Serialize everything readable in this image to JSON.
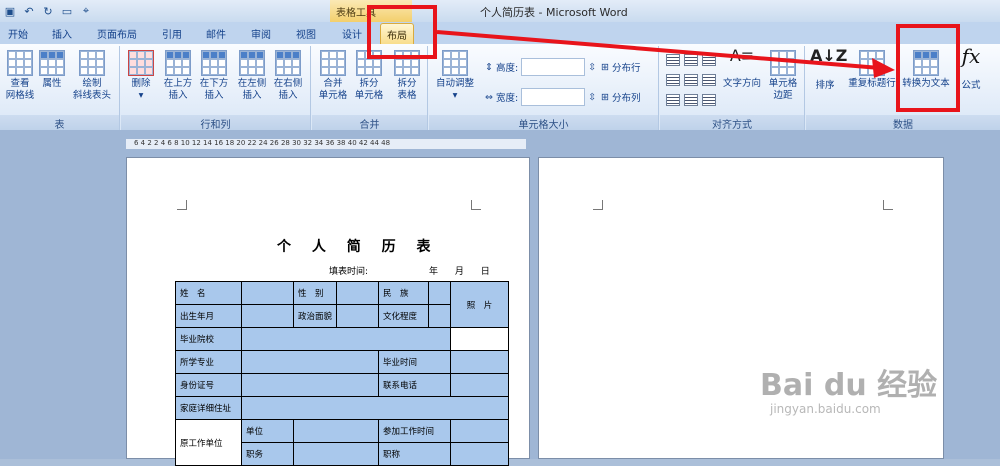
{
  "window": {
    "title": "个人简历表 - Microsoft Word",
    "context_tab_group": "表格工具"
  },
  "tabs": [
    "开始",
    "插入",
    "页面布局",
    "引用",
    "邮件",
    "审阅",
    "视图",
    "设计",
    "布局"
  ],
  "ribbon": {
    "table": {
      "label": "表",
      "buttons": [
        "查看\n网格线",
        "属性",
        "绘制\n斜线表头"
      ]
    },
    "rows_cols": {
      "label": "行和列",
      "buttons": [
        "删除",
        "在上方\n插入",
        "在下方\n插入",
        "在左侧\n插入",
        "在右侧\n插入"
      ]
    },
    "merge": {
      "label": "合并",
      "buttons": [
        "合并\n单元格",
        "拆分\n单元格",
        "拆分\n表格"
      ]
    },
    "cell_size": {
      "label": "单元格大小",
      "autofit": "自动调整",
      "height_label": "高度:",
      "width_label": "宽度:",
      "distribute_rows": "分布行",
      "distribute_cols": "分布列"
    },
    "alignment": {
      "label": "对齐方式",
      "text_direction": "文字方向",
      "cell_margins": "单元格\n边距"
    },
    "data": {
      "label": "数据",
      "sort": "排序",
      "repeat_header": "重复标题行",
      "convert_to_text": "转换为文本",
      "formula": "公式"
    }
  },
  "ruler": "6  4  2     2  4  6  8  10 12 14 16 18 20 22 24 26 28 30 32 34 36 38 40 42 44    48",
  "document": {
    "title": "个 人 简 历 表",
    "fill_time": "填表时间:",
    "ymd": "年 月 日",
    "rows": {
      "name": "姓　名",
      "gender": "性　别",
      "ethnicity": "民　族",
      "photo": "照　片",
      "birth": "出生年月",
      "political": "政治面貌",
      "education": "文化程度",
      "school": "毕业院校",
      "major": "所学专业",
      "grad_time": "毕业时间",
      "id_no": "身份证号",
      "phone": "联系电话",
      "address": "家庭详细住址",
      "former_unit": "原工作单位",
      "unit": "单位",
      "work_start": "参加工作时间",
      "position": "职务",
      "title_rank": "职称"
    }
  },
  "watermark": {
    "brand": "Bai du 经验",
    "url": "jingyan.baidu.com"
  }
}
